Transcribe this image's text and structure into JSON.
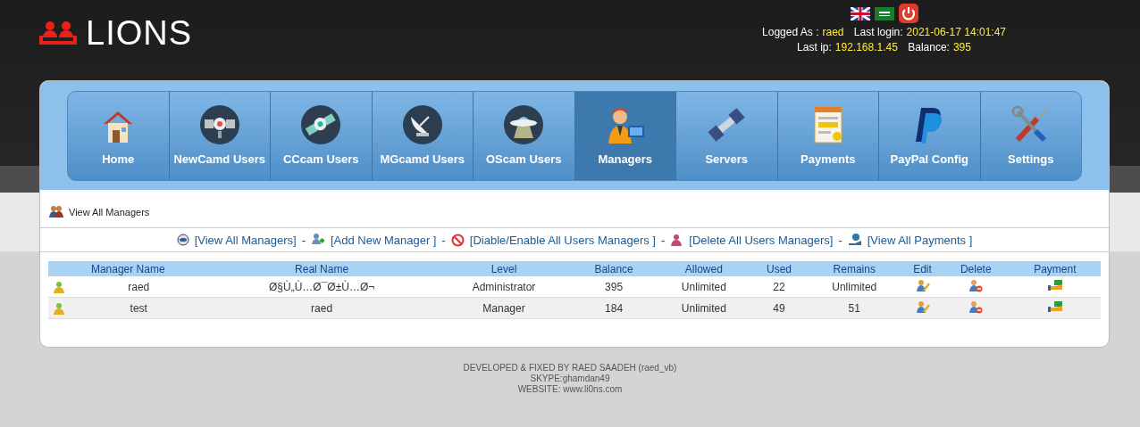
{
  "header": {
    "logo": "LIONS",
    "logged_as_label": "Logged As :",
    "user": "raed",
    "last_login_label": "Last login:",
    "last_login": "2021-06-17 14:01:47",
    "last_ip_label": "Last ip:",
    "last_ip": "192.168.1.45",
    "balance_label": "Balance:",
    "balance": "395"
  },
  "nav": {
    "items": [
      {
        "label": "Home",
        "kind": "house",
        "selected": false
      },
      {
        "label": "NewCamd Users",
        "kind": "satellite",
        "selected": false
      },
      {
        "label": "CCcam Users",
        "kind": "sat-round",
        "selected": false
      },
      {
        "label": "MGcamd Users",
        "kind": "dish",
        "selected": false
      },
      {
        "label": "OScam Users",
        "kind": "ufo",
        "selected": false
      },
      {
        "label": "Managers",
        "kind": "manager",
        "selected": true
      },
      {
        "label": "Servers",
        "kind": "station",
        "selected": false
      },
      {
        "label": "Payments",
        "kind": "card",
        "selected": false
      },
      {
        "label": "PayPal Config",
        "kind": "paypal",
        "selected": false
      },
      {
        "label": "Settings",
        "kind": "tools",
        "selected": false
      }
    ]
  },
  "page_title": "View All Managers",
  "actions": [
    {
      "label": "[View All Managers]",
      "kind": "eye"
    },
    {
      "separator": "-",
      "label": "[Add New Manager ]",
      "kind": "add"
    },
    {
      "separator": "-",
      "label": "[Diable/Enable All Users Managers ]",
      "kind": "ban"
    },
    {
      "separator": "-",
      "label": "[Delete All Users Managers]",
      "kind": "delete"
    },
    {
      "separator": "-",
      "label": "[View All Payments ]",
      "kind": "money"
    }
  ],
  "table": {
    "columns": [
      "Manager Name",
      "Real Name",
      "Level",
      "Balance",
      "Allowed",
      "Used",
      "Remains",
      "Edit",
      "Delete",
      "Payment"
    ],
    "rows": [
      {
        "cells": [
          "raed",
          "Ø§Ù„Ù…Ø¯Ø±Ù…Ø¬",
          "Administrator",
          "395",
          "Unlimited",
          "22",
          "Unlimited"
        ]
      },
      {
        "cells": [
          "test",
          "raed",
          "Manager",
          "184",
          "Unlimited",
          "49",
          "51"
        ]
      }
    ]
  },
  "footer": [
    "DEVELOPED & FIXED BY RAED SAADEH (raed_vb)",
    "SKYPE:ghamdan49",
    "WEBSITE: www.li0ns.com"
  ]
}
